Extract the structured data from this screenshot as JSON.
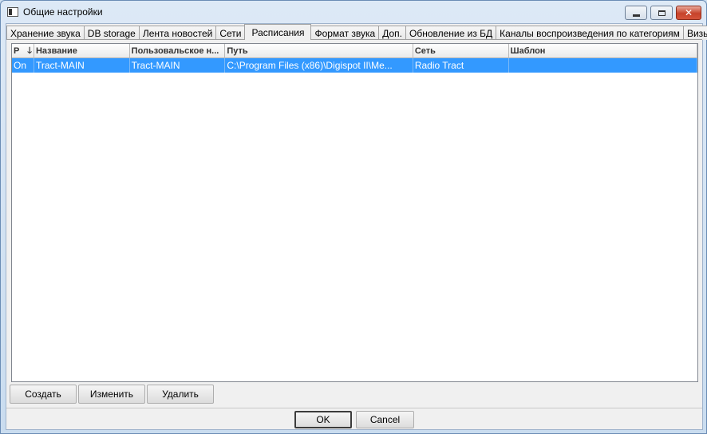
{
  "window": {
    "title": "Общие настройки",
    "controls": {
      "minimize": "",
      "maximize": "",
      "close": "✕"
    }
  },
  "tabs": [
    {
      "label": "Хранение звука",
      "active": false
    },
    {
      "label": "DB storage",
      "active": false
    },
    {
      "label": "Лента новостей",
      "active": false
    },
    {
      "label": "Сети",
      "active": false
    },
    {
      "label": "Расписания",
      "active": true
    },
    {
      "label": "Формат звука",
      "active": false
    },
    {
      "label": "Доп.",
      "active": false
    },
    {
      "label": "Обновление из БД",
      "active": false
    },
    {
      "label": "Каналы воспроизведения по категориям",
      "active": false
    },
    {
      "label": "Визы",
      "active": false
    }
  ],
  "grid": {
    "columns": [
      "Р",
      "Название",
      "Пользовальское н...",
      "Путь",
      "Сеть",
      "Шаблон"
    ],
    "sort_indicator": "🡓",
    "rows": [
      [
        "On",
        "Tract-MAIN",
        "Tract-MAIN",
        "C:\\Program Files (x86)\\Digispot II\\Me...",
        "Radio Tract",
        ""
      ]
    ]
  },
  "actions": {
    "create": "Создать",
    "edit": "Изменить",
    "delete": "Удалить"
  },
  "dialog": {
    "ok": "OK",
    "cancel": "Cancel"
  },
  "colors": {
    "selection": "#3399ff",
    "close_button": "#c7432b"
  }
}
